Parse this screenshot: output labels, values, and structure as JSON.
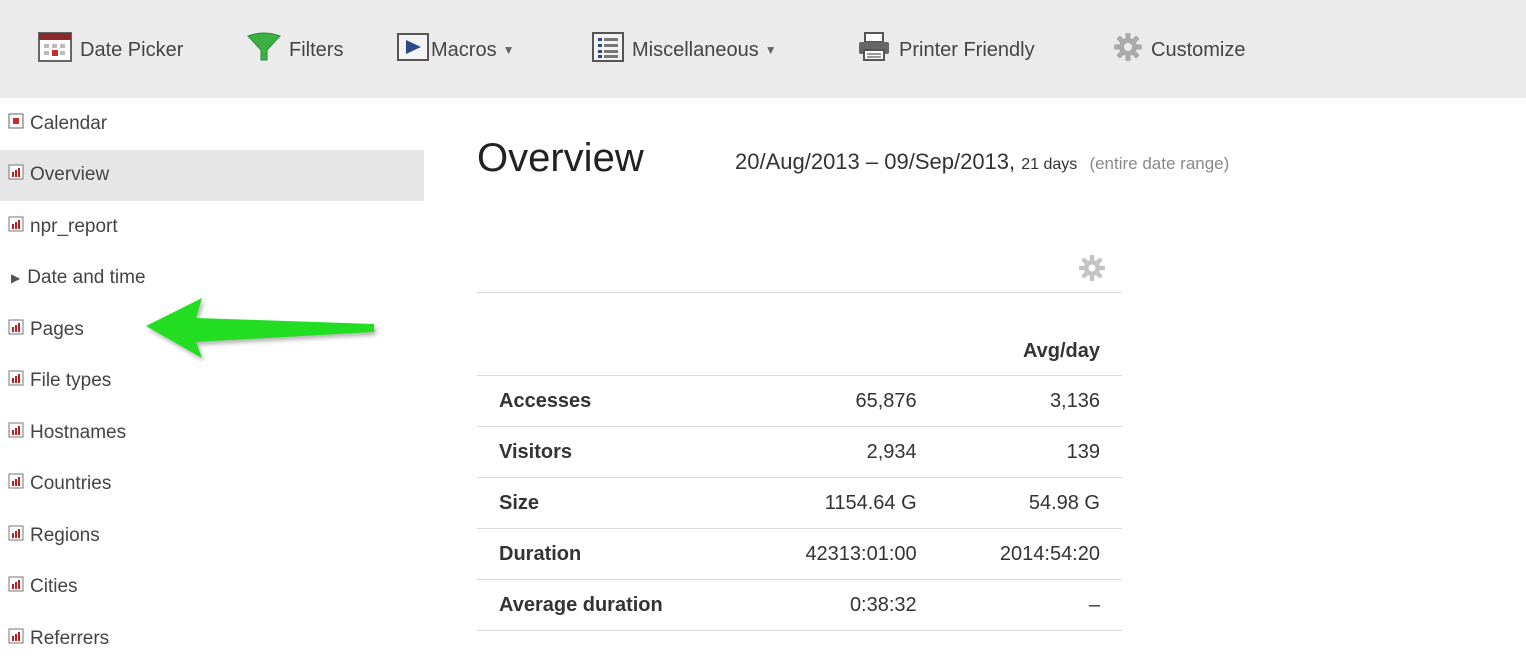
{
  "toolbar": {
    "date_picker": "Date Picker",
    "filters": "Filters",
    "macros": "Macros",
    "miscellaneous": "Miscellaneous",
    "printer_friendly": "Printer Friendly",
    "customize": "Customize"
  },
  "sidebar": {
    "items": [
      {
        "label": "Calendar",
        "icon": "calendar-icon"
      },
      {
        "label": "Overview",
        "icon": "report-icon",
        "active": true
      },
      {
        "label": "npr_report",
        "icon": "report-icon"
      },
      {
        "label": "Date and time",
        "icon": "expand-triangle-icon"
      },
      {
        "label": "Pages",
        "icon": "report-icon"
      },
      {
        "label": "File types",
        "icon": "report-icon"
      },
      {
        "label": "Hostnames",
        "icon": "report-icon"
      },
      {
        "label": "Countries",
        "icon": "report-icon"
      },
      {
        "label": "Regions",
        "icon": "report-icon"
      },
      {
        "label": "Cities",
        "icon": "report-icon"
      },
      {
        "label": "Referrers",
        "icon": "report-icon"
      }
    ]
  },
  "main": {
    "title": "Overview",
    "date_range": "20/Aug/2013 – 09/Sep/2013,",
    "days": "21 days",
    "range_note": "(entire date range)",
    "table": {
      "header": [
        "",
        "",
        "Avg/day"
      ],
      "rows": [
        {
          "label": "Accesses",
          "total": "65,876",
          "avg": "3,136"
        },
        {
          "label": "Visitors",
          "total": "2,934",
          "avg": "139"
        },
        {
          "label": "Size",
          "total": "1154.64 G",
          "avg": "54.98 G"
        },
        {
          "label": "Duration",
          "total": "42313:01:00",
          "avg": "2014:54:20"
        },
        {
          "label": "Average duration",
          "total": "0:38:32",
          "avg": "–"
        }
      ]
    }
  },
  "colors": {
    "toolbar_bg": "#ebebeb",
    "active_item_bg": "#e6e6e6",
    "arrow": "#22dd22",
    "funnel": "#3cb043",
    "report_icon": "#b22222"
  }
}
